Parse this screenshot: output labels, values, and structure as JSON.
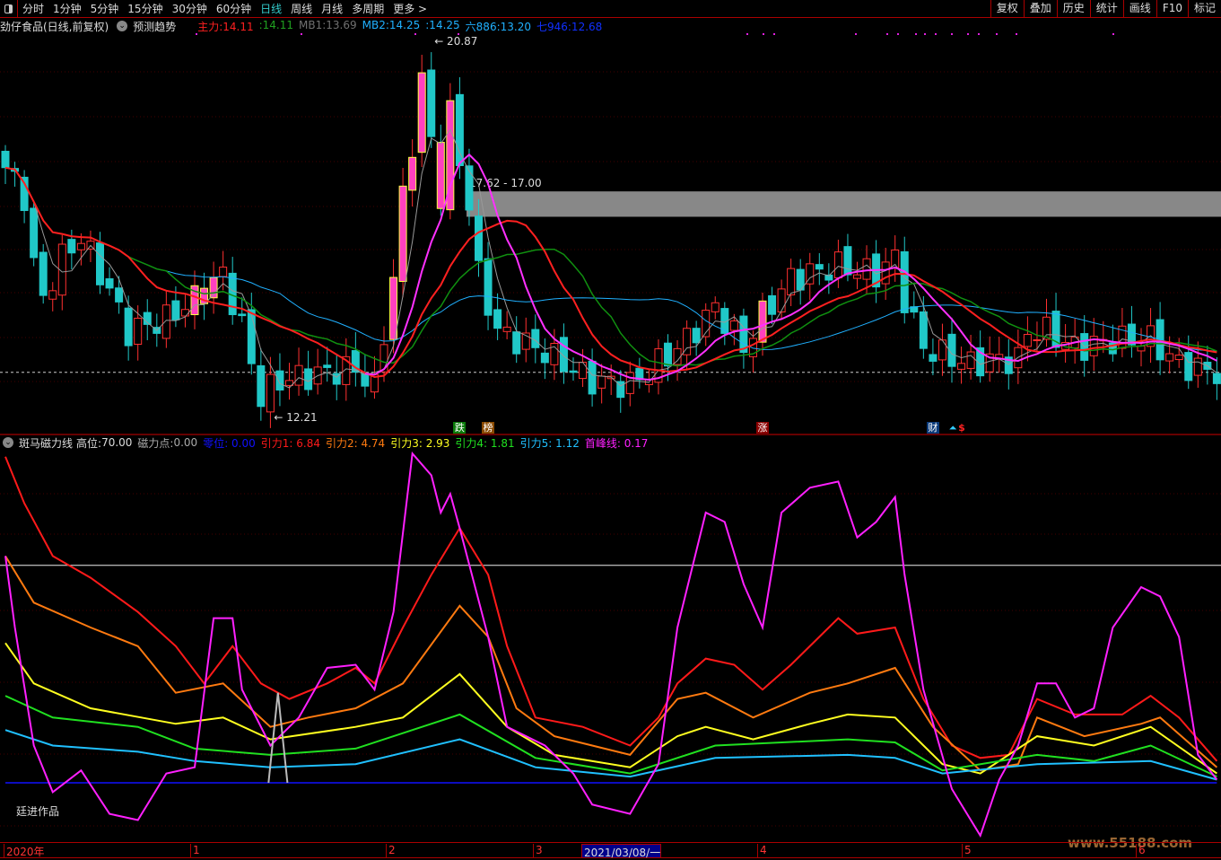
{
  "topbar": {
    "tabs": [
      "分时",
      "1分钟",
      "5分钟",
      "15分钟",
      "30分钟",
      "60分钟",
      "日线",
      "周线",
      "月线",
      "多周期",
      "更多 >"
    ],
    "active": "日线",
    "right_buttons": [
      "复权",
      "叠加",
      "历史",
      "统计",
      "画线",
      "F10",
      "标记"
    ]
  },
  "main_header": {
    "title": "劲仔食品(日线,前复权)",
    "predict": "预测趋势",
    "items": [
      {
        "label": "主力:",
        "value": "14.11",
        "color": "#ff2020"
      },
      {
        "label": ":",
        "value": "14.11",
        "color": "#20a020"
      },
      {
        "label": "MB1:",
        "value": "13.69",
        "color": "#707070"
      },
      {
        "label": "MB2:",
        "value": "14.25",
        "color": "#20b0ff"
      },
      {
        "label": ":",
        "value": "14.25",
        "color": "#20b0ff"
      },
      {
        "label": "六886:",
        "value": "13.20",
        "color": "#20b0ff"
      },
      {
        "label": "七946:",
        "value": "12.68",
        "color": "#1030ff"
      }
    ]
  },
  "price_annotations": {
    "high": "20.87",
    "low": "12.21",
    "band": "17.62 - 17.00",
    "band_low": 17.0,
    "band_high": 17.62,
    "dashed_level": 13.2
  },
  "event_tags": [
    {
      "text": "跌",
      "day": 48,
      "color": "#0a7a0a"
    },
    {
      "text": "榜",
      "day": 51,
      "color": "#8a4a00"
    },
    {
      "text": "涨",
      "day": 80,
      "color": "#8b0000"
    },
    {
      "text": "财",
      "day": 98,
      "color": "#0a3a7a"
    }
  ],
  "chart_data": {
    "type": "candlestick",
    "price_range": [
      12.0,
      21.3
    ],
    "price_path": [
      [
        0,
        18.2
      ],
      [
        2,
        17.5
      ],
      [
        3,
        15.8
      ],
      [
        4,
        15.0
      ],
      [
        6,
        16.0
      ],
      [
        8,
        16.5
      ],
      [
        11,
        15.2
      ],
      [
        13,
        14.2
      ],
      [
        17,
        14.5
      ],
      [
        20,
        15.0
      ],
      [
        23,
        15.6
      ],
      [
        25,
        14.3
      ],
      [
        27,
        12.6
      ],
      [
        29,
        13.0
      ],
      [
        34,
        13.2
      ],
      [
        37,
        13.3
      ],
      [
        39,
        12.8
      ],
      [
        41,
        15.5
      ],
      [
        42,
        17.5
      ],
      [
        43,
        18.8
      ],
      [
        44,
        20.3
      ],
      [
        46,
        17.5
      ],
      [
        47,
        19.5
      ],
      [
        49,
        17.3
      ],
      [
        50,
        15.6
      ],
      [
        52,
        14.2
      ],
      [
        54,
        14.0
      ],
      [
        57,
        13.7
      ],
      [
        62,
        13.0
      ],
      [
        66,
        12.9
      ],
      [
        70,
        13.6
      ],
      [
        72,
        14.0
      ],
      [
        75,
        14.8
      ],
      [
        78,
        13.8
      ],
      [
        80,
        14.6
      ],
      [
        83,
        15.5
      ],
      [
        88,
        15.8
      ],
      [
        92,
        15.6
      ],
      [
        94,
        16.0
      ],
      [
        95,
        15.0
      ],
      [
        97,
        13.8
      ],
      [
        102,
        13.4
      ],
      [
        104,
        13.5
      ],
      [
        107,
        13.5
      ],
      [
        108,
        14.2
      ],
      [
        110,
        14.2
      ],
      [
        113,
        13.8
      ],
      [
        118,
        14.0
      ],
      [
        121,
        14.0
      ],
      [
        124,
        13.4
      ],
      [
        128,
        13.2
      ]
    ],
    "indicator": {
      "title": "斑马磁力线",
      "high_label": "高位:",
      "high": "70.00",
      "magnet_label": "磁力点:",
      "magnet": "0.00",
      "range": [
        -20,
        110
      ],
      "series": [
        {
          "name": "零位",
          "value": "0.00",
          "color": "#1010ff",
          "points": [
            [
              0,
              0
            ],
            [
              128,
              0
            ]
          ]
        },
        {
          "name": "引力1",
          "value": "6.84",
          "color": "#ff1a1a",
          "points": [
            [
              0,
              105
            ],
            [
              2,
              90
            ],
            [
              5,
              73
            ],
            [
              9,
              66
            ],
            [
              14,
              55
            ],
            [
              18,
              44
            ],
            [
              21,
              32
            ],
            [
              24,
              44
            ],
            [
              27,
              32
            ],
            [
              30,
              27
            ],
            [
              34,
              32
            ],
            [
              37,
              37
            ],
            [
              39,
              32
            ],
            [
              42,
              50
            ],
            [
              45,
              67
            ],
            [
              48,
              82
            ],
            [
              51,
              67
            ],
            [
              53,
              44
            ],
            [
              56,
              21
            ],
            [
              61,
              18
            ],
            [
              66,
              12
            ],
            [
              69,
              21
            ],
            [
              71,
              32
            ],
            [
              74,
              40
            ],
            [
              77,
              38
            ],
            [
              80,
              30
            ],
            [
              83,
              38
            ],
            [
              88,
              53
            ],
            [
              90,
              48
            ],
            [
              94,
              50
            ],
            [
              97,
              27
            ],
            [
              100,
              12
            ],
            [
              103,
              8
            ],
            [
              106,
              9
            ],
            [
              109,
              27
            ],
            [
              113,
              22
            ],
            [
              118,
              22
            ],
            [
              121,
              28
            ],
            [
              124,
              21
            ],
            [
              128,
              7
            ]
          ]
        },
        {
          "name": "引力2",
          "value": "4.74",
          "color": "#ff7a10",
          "points": [
            [
              0,
              73
            ],
            [
              3,
              58
            ],
            [
              9,
              50
            ],
            [
              14,
              44
            ],
            [
              18,
              29
            ],
            [
              23,
              32
            ],
            [
              28,
              18
            ],
            [
              32,
              21
            ],
            [
              37,
              24
            ],
            [
              42,
              32
            ],
            [
              48,
              57
            ],
            [
              51,
              47
            ],
            [
              54,
              24
            ],
            [
              58,
              15
            ],
            [
              66,
              9
            ],
            [
              71,
              27
            ],
            [
              74,
              29
            ],
            [
              79,
              21
            ],
            [
              85,
              29
            ],
            [
              89,
              32
            ],
            [
              94,
              37
            ],
            [
              98,
              18
            ],
            [
              103,
              4
            ],
            [
              107,
              6
            ],
            [
              109,
              21
            ],
            [
              114,
              15
            ],
            [
              120,
              19
            ],
            [
              122,
              21
            ],
            [
              128,
              5
            ]
          ]
        },
        {
          "name": "引力3",
          "value": "2.93",
          "color": "#ffff20",
          "points": [
            [
              0,
              45
            ],
            [
              3,
              32
            ],
            [
              9,
              24
            ],
            [
              18,
              19
            ],
            [
              23,
              21
            ],
            [
              28,
              14
            ],
            [
              37,
              18
            ],
            [
              42,
              21
            ],
            [
              48,
              35
            ],
            [
              53,
              18
            ],
            [
              58,
              9
            ],
            [
              66,
              5
            ],
            [
              71,
              15
            ],
            [
              74,
              18
            ],
            [
              79,
              14
            ],
            [
              85,
              19
            ],
            [
              89,
              22
            ],
            [
              94,
              21
            ],
            [
              99,
              6
            ],
            [
              103,
              3
            ],
            [
              109,
              15
            ],
            [
              115,
              12
            ],
            [
              121,
              18
            ],
            [
              128,
              3
            ]
          ]
        },
        {
          "name": "引力4",
          "value": "1.81",
          "color": "#20e020",
          "points": [
            [
              0,
              28
            ],
            [
              5,
              21
            ],
            [
              14,
              18
            ],
            [
              20,
              11
            ],
            [
              28,
              9
            ],
            [
              37,
              11
            ],
            [
              48,
              22
            ],
            [
              56,
              8
            ],
            [
              66,
              3
            ],
            [
              75,
              12
            ],
            [
              89,
              14
            ],
            [
              94,
              13
            ],
            [
              99,
              4
            ],
            [
              109,
              9
            ],
            [
              115,
              7
            ],
            [
              121,
              12
            ],
            [
              128,
              2
            ]
          ]
        },
        {
          "name": "引力5",
          "value": "1.12",
          "color": "#20c0ff",
          "points": [
            [
              0,
              17
            ],
            [
              5,
              12
            ],
            [
              14,
              10
            ],
            [
              20,
              7
            ],
            [
              28,
              5
            ],
            [
              37,
              6
            ],
            [
              48,
              14
            ],
            [
              56,
              5
            ],
            [
              66,
              2
            ],
            [
              75,
              8
            ],
            [
              89,
              9
            ],
            [
              94,
              8
            ],
            [
              99,
              3
            ],
            [
              109,
              6
            ],
            [
              121,
              7
            ],
            [
              128,
              1
            ]
          ]
        },
        {
          "name": "首峰线",
          "value": "0.17",
          "color": "#ff20ff",
          "points": [
            [
              0,
              73
            ],
            [
              1,
              50
            ],
            [
              3,
              12
            ],
            [
              5,
              -3
            ],
            [
              8,
              4
            ],
            [
              11,
              -10
            ],
            [
              14,
              -12
            ],
            [
              17,
              3
            ],
            [
              20,
              5
            ],
            [
              22,
              53
            ],
            [
              24,
              53
            ],
            [
              25,
              30
            ],
            [
              28,
              12
            ],
            [
              31,
              21
            ],
            [
              34,
              37
            ],
            [
              37,
              38
            ],
            [
              39,
              30
            ],
            [
              41,
              55
            ],
            [
              43,
              106
            ],
            [
              45,
              99
            ],
            [
              46,
              87
            ],
            [
              47,
              93
            ],
            [
              48,
              82
            ],
            [
              51,
              47
            ],
            [
              53,
              18
            ],
            [
              57,
              12
            ],
            [
              60,
              3
            ],
            [
              62,
              -7
            ],
            [
              66,
              -10
            ],
            [
              69,
              6
            ],
            [
              71,
              50
            ],
            [
              74,
              87
            ],
            [
              76,
              84
            ],
            [
              78,
              64
            ],
            [
              80,
              50
            ],
            [
              82,
              87
            ],
            [
              85,
              95
            ],
            [
              88,
              97
            ],
            [
              90,
              79
            ],
            [
              92,
              84
            ],
            [
              94,
              92
            ],
            [
              95,
              67
            ],
            [
              97,
              30
            ],
            [
              100,
              -2
            ],
            [
              103,
              -17
            ],
            [
              105,
              1
            ],
            [
              107,
              12
            ],
            [
              109,
              32
            ],
            [
              111,
              32
            ],
            [
              113,
              21
            ],
            [
              115,
              24
            ],
            [
              117,
              50
            ],
            [
              120,
              63
            ],
            [
              122,
              60
            ],
            [
              124,
              47
            ],
            [
              126,
              9
            ],
            [
              128,
              1
            ]
          ]
        },
        {
          "name": "",
          "value": "",
          "color": "#bbbbbb",
          "points": [
            [
              27.8,
              0
            ],
            [
              28.8,
              29
            ],
            [
              29.8,
              0
            ]
          ]
        }
      ]
    },
    "x_axis": [
      "2020年",
      "1",
      "2",
      "3",
      "2021/03/08/一",
      "4",
      "5",
      "6"
    ]
  },
  "footer_label": "廷进作品",
  "watermark_site": "www.55188.com"
}
